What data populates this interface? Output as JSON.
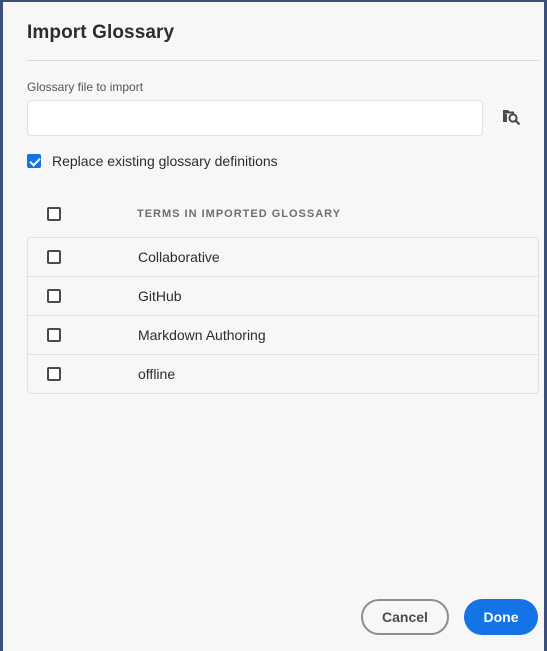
{
  "dialog": {
    "title": "Import Glossary"
  },
  "file_field": {
    "label": "Glossary file to import",
    "value": "",
    "placeholder": "",
    "browse_icon": "folder-search-icon"
  },
  "replace_option": {
    "label": "Replace existing glossary definitions",
    "checked": true
  },
  "table": {
    "header": "TERMS IN IMPORTED GLOSSARY",
    "select_all_checked": false,
    "rows": [
      {
        "label": "Collaborative",
        "checked": false
      },
      {
        "label": "GitHub",
        "checked": false
      },
      {
        "label": "Markdown Authoring",
        "checked": false
      },
      {
        "label": "offline",
        "checked": false
      }
    ]
  },
  "buttons": {
    "cancel": "Cancel",
    "done": "Done"
  },
  "colors": {
    "accent": "#1473e6",
    "window_border": "#3b4f7a"
  }
}
